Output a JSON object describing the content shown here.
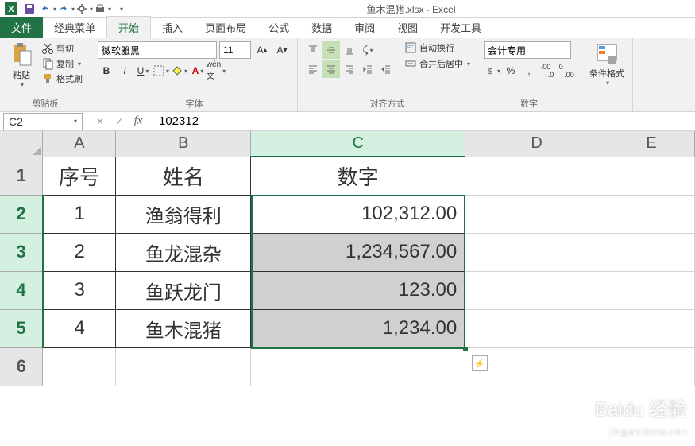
{
  "title": {
    "filename": "鱼木混猪.xlsx",
    "app": "Excel"
  },
  "qat": [
    "save",
    "undo",
    "redo",
    "touch",
    "quickprint",
    "new"
  ],
  "tabs": {
    "file": "文件",
    "items": [
      "经典菜单",
      "开始",
      "插入",
      "页面布局",
      "公式",
      "数据",
      "审阅",
      "视图",
      "开发工具"
    ],
    "active": 1
  },
  "ribbon": {
    "clipboard": {
      "paste": "粘贴",
      "cut": "剪切",
      "copy": "复制",
      "format_painter": "格式刷",
      "group": "剪贴板"
    },
    "font": {
      "name": "微软雅黑",
      "size": "11",
      "group": "字体"
    },
    "alignment": {
      "wrap": "自动换行",
      "merge": "合并后居中",
      "group": "对齐方式"
    },
    "number": {
      "format": "会计专用",
      "group": "数字"
    },
    "styles": {
      "conditional": "条件格式",
      "group": ""
    }
  },
  "formulabar": {
    "namebox": "C2",
    "formula": "102312"
  },
  "grid": {
    "columns": [
      "A",
      "B",
      "C",
      "D",
      "E"
    ],
    "active_col": "C",
    "rows": [
      "1",
      "2",
      "3",
      "4",
      "5",
      "6"
    ],
    "active_rows": [
      "2",
      "3",
      "4",
      "5"
    ],
    "headers": {
      "a": "序号",
      "b": "姓名",
      "c": "数字"
    },
    "data": [
      {
        "seq": "1",
        "name": "渔翁得利",
        "num": "102,312.00"
      },
      {
        "seq": "2",
        "name": "鱼龙混杂",
        "num": "1,234,567.00"
      },
      {
        "seq": "3",
        "name": "鱼跃龙门",
        "num": "123.00"
      },
      {
        "seq": "4",
        "name": "鱼木混猪",
        "num": "1,234.00"
      }
    ]
  },
  "watermark": {
    "main": "Baidu 经验",
    "sub": "jingyan.baidu.com"
  }
}
